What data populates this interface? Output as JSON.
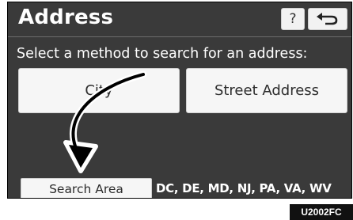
{
  "header": {
    "title": "Address",
    "help_label": "?",
    "back_icon": "return-arrow-icon"
  },
  "instruction": "Select a method to search for an address:",
  "buttons": {
    "city": "City",
    "street_address": "Street Address",
    "search_area": "Search Area"
  },
  "search_area_value": "DC, DE, MD, NJ, PA, VA, WV",
  "figure_code": "U2002FC",
  "colors": {
    "screen_bg": "#3a3a3a",
    "button_bg": "#f6f6f6",
    "text_light": "#ffffff"
  }
}
